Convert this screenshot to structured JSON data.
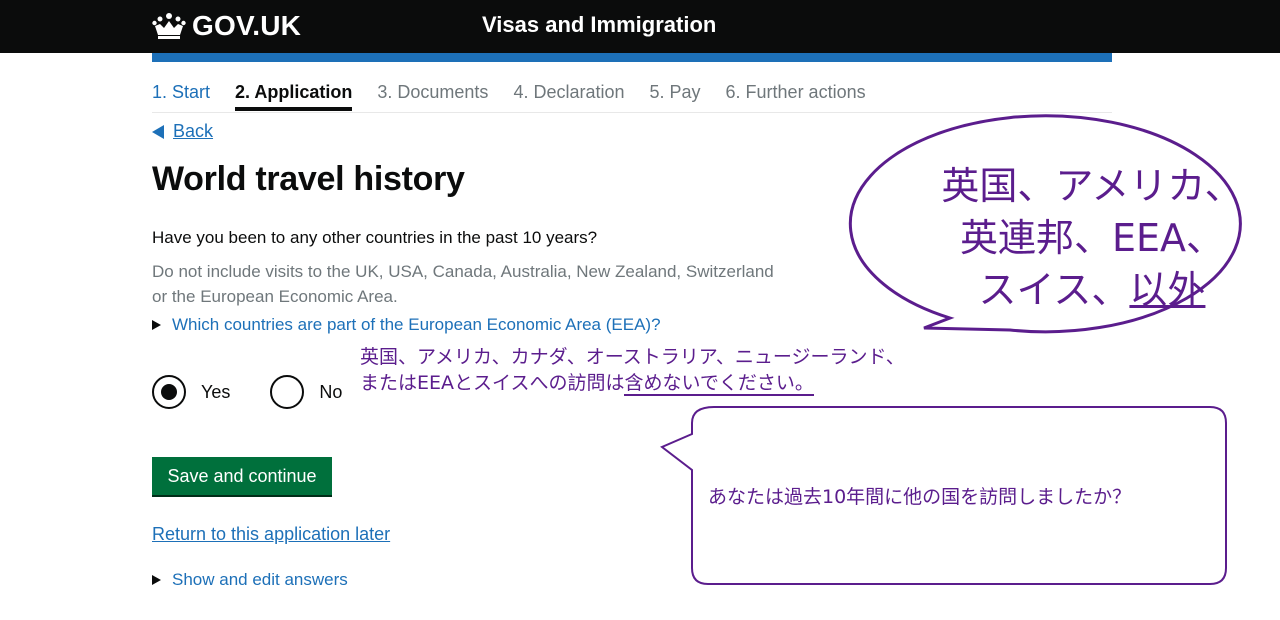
{
  "header": {
    "logo_text": "GOV.UK",
    "service_name": "Visas and Immigration"
  },
  "steps": [
    "1. Start",
    "2. Application",
    "3. Documents",
    "4. Declaration",
    "5. Pay",
    "6. Further actions"
  ],
  "current_step": 1,
  "back_link": "Back",
  "page_title": "World travel history",
  "question": "Have you been to any other countries in the past 10 years?",
  "hint_line1": "Do not include visits to the UK, USA, Canada, Australia, New Zealand, Switzerland",
  "hint_line2": "or the European Economic Area.",
  "details_eea": "Which countries are part of the European Economic Area (EEA)?",
  "radios": {
    "yes": "Yes",
    "no": "No",
    "selected": "Yes"
  },
  "save_button": "Save and continue",
  "return_link": "Return to this application later",
  "details_answers": "Show and edit answers",
  "annotations": {
    "bubble1_line1": "英国、アメリカ、",
    "bubble1_line2": "英連邦、EEA、",
    "bubble1_line3_a": "スイス、",
    "bubble1_line3_b": "以外",
    "note2_line1": "英国、アメリカ、カナダ、オーストラリア、ニュージーランド、",
    "note2_line2_a": "またはEEAとスイスへの訪問は",
    "note2_line2_b": "含めないでください。",
    "bubble3": "あなたは過去10年間に他の国を訪問しましたか？"
  },
  "colors": {
    "header": "#0b0c0c",
    "bar": "#1d70b8",
    "link": "#1d70b8",
    "button": "#00703c",
    "annotation": "#5b1d8d"
  }
}
